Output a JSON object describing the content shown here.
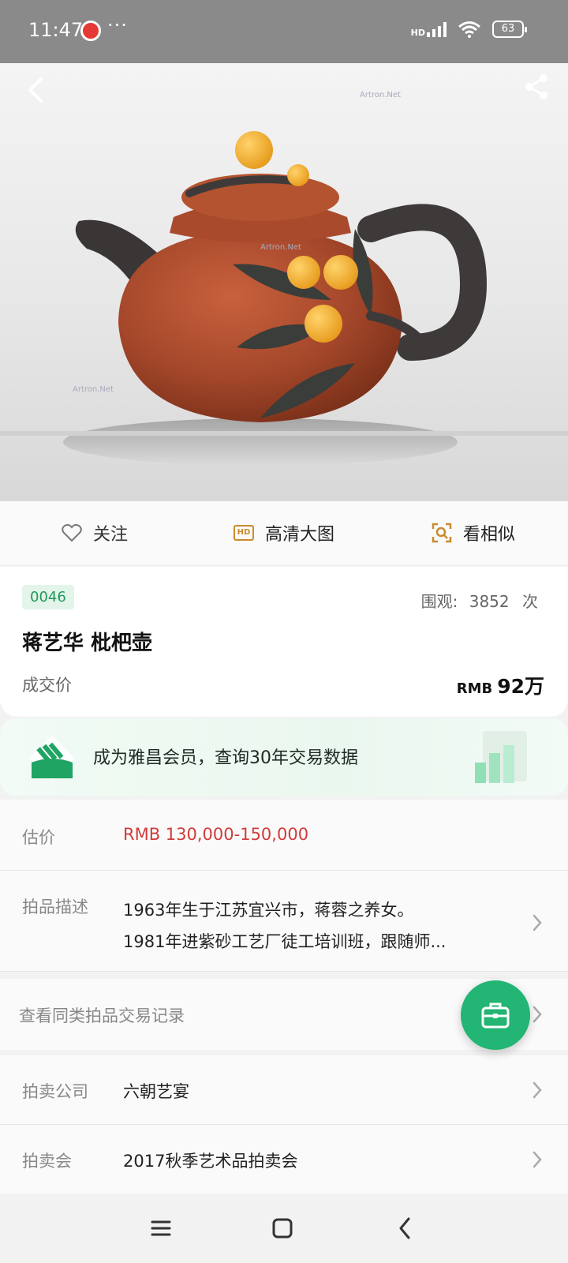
{
  "status_bar": {
    "time": "11:47",
    "dots": "···",
    "network": "HD",
    "battery": "63"
  },
  "hero": {
    "watermark_1": "Artron.Net",
    "watermark_2": "Artron.Net",
    "watermark_3": "Artron.Net"
  },
  "actions": {
    "follow": "关注",
    "hd_icon": "HD",
    "hd_image": "高清大图",
    "similar": "看相似"
  },
  "lot": {
    "number": "0046",
    "views_label": "围观:",
    "views_count": "3852",
    "views_unit": "次",
    "title": "蒋艺华 枇杷壶",
    "deal_label": "成交价",
    "deal_currency": "RMB",
    "deal_amount": "92万"
  },
  "member": {
    "text": "成为雅昌会员，查询30年交易数据"
  },
  "details": {
    "estimate_label": "估价",
    "estimate_value": "RMB  130,000-150,000",
    "desc_label": "拍品描述",
    "desc_line1": "1963年生于江苏宜兴市，蒋蓉之养女。",
    "desc_line2": "1981年进紫砂工艺厂徒工培训班，跟随师...",
    "records_label": "查看同类拍品交易记录",
    "company_label": "拍卖公司",
    "company_value": "六朝艺宴",
    "auction_label": "拍卖会",
    "auction_value": "2017秋季艺术品拍卖会"
  },
  "colors": {
    "accent_green": "#22b573",
    "price_red": "#d23b3b",
    "badge_green": "#1f9a58"
  },
  "icons": [
    "back-icon",
    "share-icon",
    "heart-icon",
    "hd-icon",
    "scan-search-icon",
    "chevron-right-icon",
    "briefcase-icon",
    "menu-icon",
    "home-icon",
    "back-nav-icon"
  ]
}
